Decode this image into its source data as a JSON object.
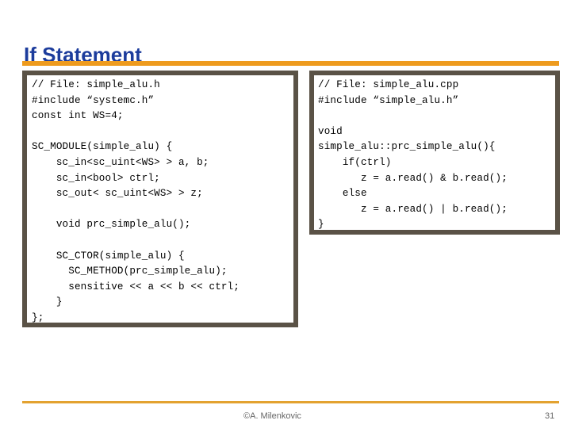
{
  "slide": {
    "title": "If Statement",
    "accent_color": "#EE9B1E",
    "title_color": "#1C3C9C",
    "box_border_color": "#5A5246",
    "background_color": "#FFFFFF"
  },
  "code_left": {
    "filename_comment": "// File: simple_alu.h",
    "content": "// File: simple_alu.h\n#include “systemc.h”\nconst int WS=4;\n\nSC_MODULE(simple_alu) {\n    sc_in<sc_uint<WS> > a, b;\n    sc_in<bool> ctrl;\n    sc_out< sc_uint<WS> > z;\n\n    void prc_simple_alu();\n\n    SC_CTOR(simple_alu) {\n      SC_METHOD(prc_simple_alu);\n      sensitive << a << b << ctrl;\n    }\n};",
    "lines": [
      "// File: simple_alu.h",
      "#include “systemc.h”",
      "const int WS=4;",
      "",
      "SC_MODULE(simple_alu) {",
      "    sc_in<sc_uint<WS> > a, b;",
      "    sc_in<bool> ctrl;",
      "    sc_out< sc_uint<WS> > z;",
      "",
      "    void prc_simple_alu();",
      "",
      "    SC_CTOR(simple_alu) {",
      "      SC_METHOD(prc_simple_alu);",
      "      sensitive << a << b << ctrl;",
      "    }",
      "};"
    ]
  },
  "code_right": {
    "filename_comment": "// File: simple_alu.cpp",
    "content": "// File: simple_alu.cpp\n#include “simple_alu.h”\n\nvoid\nsimple_alu::prc_simple_alu(){\n    if(ctrl)\n       z = a.read() & b.read();\n    else\n       z = a.read() | b.read();\n}",
    "lines": [
      "// File: simple_alu.cpp",
      "#include “simple_alu.h”",
      "",
      "void",
      "simple_alu::prc_simple_alu(){",
      "    if(ctrl)",
      "       z = a.read() & b.read();",
      "    else",
      "       z = a.read() | b.read();",
      "}"
    ]
  },
  "footer": {
    "author": "©A. Milenkovic",
    "page_number": "31",
    "rule_color": "#E3A230"
  }
}
